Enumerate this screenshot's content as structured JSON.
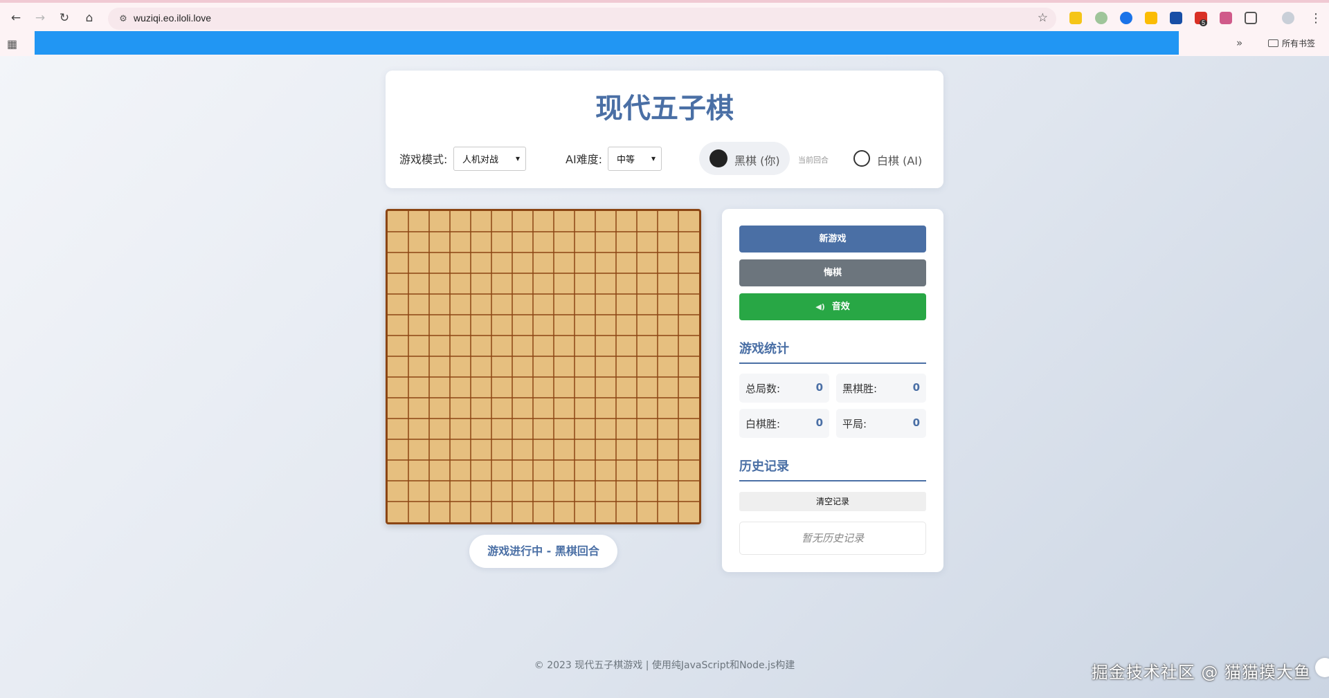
{
  "browser": {
    "url": "wuziqi.eo.iloli.love",
    "bookmarks_folder": "所有书签",
    "extension_badge": "5"
  },
  "header": {
    "title": "现代五子棋",
    "mode_label": "游戏模式:",
    "mode_value": "人机对战",
    "difficulty_label": "AI难度:",
    "difficulty_value": "中等",
    "black_player": "黑棋 (你)",
    "turn_hint": "当前回合",
    "white_player": "白棋 (AI)"
  },
  "board": {
    "lines": 15,
    "wood_color": "#e6bf7f",
    "line_color": "#8b4513"
  },
  "status": "游戏进行中 - 黑棋回合",
  "sidebar": {
    "new_game": "新游戏",
    "undo": "悔棋",
    "sound": "音效",
    "stats_title": "游戏统计",
    "stats": {
      "total_label": "总局数:",
      "total": "0",
      "black_wins_label": "黑棋胜:",
      "black_wins": "0",
      "white_wins_label": "白棋胜:",
      "white_wins": "0",
      "draws_label": "平局:",
      "draws": "0"
    },
    "history_title": "历史记录",
    "clear_history": "清空记录",
    "history_empty": "暂无历史记录"
  },
  "footer": "© 2023 现代五子棋游戏 | 使用纯JavaScript和Node.js构建",
  "watermark": "掘金技术社区 @ 猫猫摸大鱼",
  "colors": {
    "primary": "#4a6fa5",
    "secondary": "#6c757d",
    "success": "#28a745",
    "bookmark_strip": "#2196f3"
  }
}
